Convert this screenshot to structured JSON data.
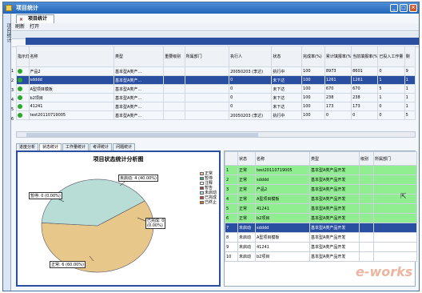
{
  "window": {
    "title": "项目统计",
    "buttons": [
      "_",
      "□",
      "×"
    ]
  },
  "sidebar": {
    "label": "项目统计"
  },
  "doc_tab": {
    "label": "项目统计",
    "close": "×"
  },
  "toolbar": {
    "items": [
      "刷新",
      "打开"
    ]
  },
  "main_table": {
    "headers": [
      "指示灯",
      "名称",
      "类型",
      "重要级别",
      "所属部门",
      "执行人",
      "状态",
      "完成率(%)",
      "累计填报率(%)",
      "当前填报率(%)",
      "已投入工作量",
      "剩"
    ],
    "rows": [
      {
        "num": "1",
        "name": "产品2",
        "type": "基本型A类产…",
        "level": "",
        "dept": "",
        "executor": "20050203 (李达)",
        "status": "执行中",
        "complete": "100",
        "cum": "8973",
        "cur": "8601",
        "invest": "0",
        "rest": "9"
      },
      {
        "num": "2",
        "name": "sdddd",
        "type": "基本型A类产…",
        "level": "",
        "dept": "",
        "executor": "0",
        "status": "未下达",
        "complete": "100",
        "cum": "1261",
        "cur": "1261",
        "invest": "1",
        "rest": "1"
      },
      {
        "num": "3",
        "name": "A型项目模板",
        "type": "基本型A类产…",
        "level": "",
        "dept": "",
        "executor": "0",
        "status": "未下达",
        "complete": "100",
        "cum": "670",
        "cur": "670",
        "invest": "5",
        "rest": "1"
      },
      {
        "num": "4",
        "name": "b2项目",
        "type": "基本型A类产…",
        "level": "",
        "dept": "",
        "executor": "0",
        "status": "未下达",
        "complete": "100",
        "cum": "238",
        "cur": "238",
        "invest": "1",
        "rest": "1"
      },
      {
        "num": "5",
        "name": "41241",
        "type": "基本型A类产…",
        "level": "",
        "dept": "",
        "executor": "0",
        "status": "未下达",
        "complete": "100",
        "cum": "173",
        "cur": "173",
        "invest": "0",
        "rest": "1"
      },
      {
        "num": "6",
        "name": "test20110719005",
        "type": "基本型A类产…",
        "level": "",
        "dept": "",
        "executor": "20050203 (李达)",
        "status": "执行中",
        "complete": "100",
        "cum": "0",
        "cur": "0",
        "invest": "0",
        "rest": "5"
      }
    ]
  },
  "sub_tabs": [
    "进度分析",
    "状态统计",
    "工作量统计",
    "考评统计",
    "问题统计"
  ],
  "chart_data": {
    "type": "pie",
    "title": "项目状态统计分析图",
    "slices": [
      {
        "label": "正常",
        "value": 6,
        "pct": "60.00%",
        "color": "#e8c88a"
      },
      {
        "label": "未启动",
        "value": 4,
        "pct": "40.00%",
        "color": "#b8ddd6"
      },
      {
        "label": "暂停",
        "value": 0,
        "pct": "0.00%",
        "color": "#3aa87a"
      },
      {
        "label": "已完成",
        "value": 0,
        "pct": "0.00%",
        "color": "#d04040"
      }
    ],
    "labels": {
      "normal": "正常: 6 (60.00%)",
      "notstart": "未启动: 4 (40.00%)",
      "pause": "暂停: 0 (0.00%)",
      "done1": "已完成: 0",
      "done2": "(0.00%)"
    },
    "legend": [
      "正常",
      "暂停",
      "注释",
      "暂告",
      "未启动",
      "已完成",
      "已终止"
    ],
    "legend_colors": [
      "#e8c88a",
      "#3aa87a",
      "#ffffff",
      "#b04040",
      "#b8ddd6",
      "#d04040",
      "#e07020"
    ]
  },
  "right_table": {
    "headers": [
      "状态",
      "名称",
      "类型",
      "级别",
      "所属部门"
    ],
    "rows": [
      {
        "num": "1",
        "status": "正常",
        "name": "test20110719005",
        "type": "基本型A类产品开发",
        "style": "green"
      },
      {
        "num": "2",
        "status": "正常",
        "name": "sdddd",
        "type": "基本型A类产品开发",
        "style": "green"
      },
      {
        "num": "3",
        "status": "正常",
        "name": "产品2",
        "type": "基本型A类产品开发",
        "style": "green"
      },
      {
        "num": "4",
        "status": "正常",
        "name": "A型项目模板",
        "type": "基本型A类产品开发",
        "style": "green"
      },
      {
        "num": "5",
        "status": "正常",
        "name": "41241",
        "type": "基本型A类产品开发",
        "style": "green"
      },
      {
        "num": "6",
        "status": "正常",
        "name": "b2项目",
        "type": "基本型A类产品开发",
        "style": "green"
      },
      {
        "num": "7",
        "status": "未启动",
        "name": "sdddd",
        "type": "基本型A类产品开发",
        "style": "sel"
      },
      {
        "num": "8",
        "status": "未启动",
        "name": "A型项目模板",
        "type": "基本型A类产品开发",
        "style": "white"
      },
      {
        "num": "9",
        "status": "未启动",
        "name": "41241",
        "type": "基本型A类产品开发",
        "style": "white"
      },
      {
        "num": "10",
        "status": "未启动",
        "name": "b2项目",
        "type": "基本型A类产品开发",
        "style": "white"
      }
    ]
  },
  "watermark": "e-works"
}
